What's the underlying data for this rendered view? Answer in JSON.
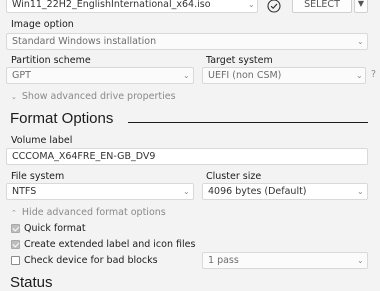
{
  "top": {
    "iso_filename": "Win11_22H2_EnglishInternational_x64.iso",
    "verify_icon": "check-circle-icon",
    "select_label": "SELECT"
  },
  "drive_properties": {
    "image_option_label": "Image option",
    "image_option_value": "Standard Windows installation",
    "partition_scheme_label": "Partition scheme",
    "partition_scheme_value": "GPT",
    "target_system_label": "Target system",
    "target_system_value": "UEFI (non CSM)",
    "help_mark": "?",
    "advanced_toggle": "Show advanced drive properties"
  },
  "format_options": {
    "title": "Format Options",
    "volume_label_label": "Volume label",
    "volume_label_value": "CCCOMA_X64FRE_EN-GB_DV9",
    "file_system_label": "File system",
    "file_system_value": "NTFS",
    "cluster_size_label": "Cluster size",
    "cluster_size_value": "4096 bytes (Default)",
    "advanced_toggle": "Hide advanced format options",
    "quick_format_label": "Quick format",
    "quick_format_checked": true,
    "extended_label_label": "Create extended label and icon files",
    "extended_label_checked": true,
    "bad_blocks_label": "Check device for bad blocks",
    "bad_blocks_checked": false,
    "passes_value": "1 pass"
  },
  "status": {
    "title": "Status"
  }
}
